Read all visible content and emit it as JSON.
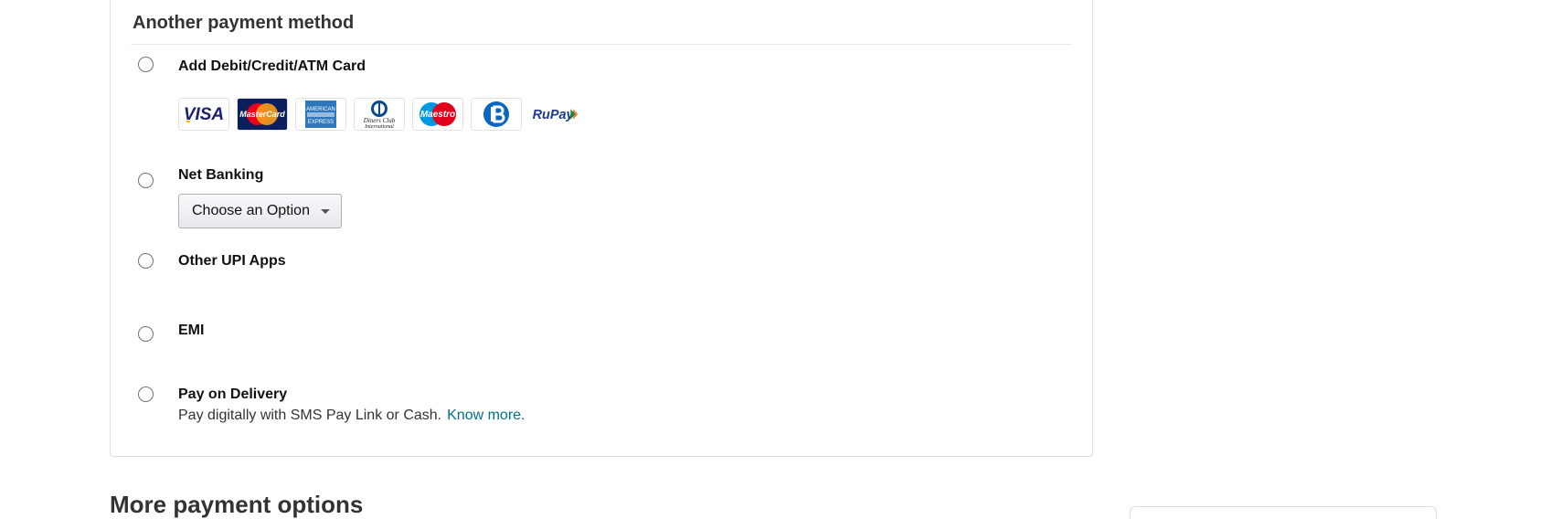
{
  "section": {
    "title": "Another payment method"
  },
  "options": {
    "card": {
      "label": "Add Debit/Credit/ATM Card"
    },
    "net_banking": {
      "label": "Net Banking",
      "select_value": "Choose an Option"
    },
    "upi": {
      "label": "Other UPI Apps"
    },
    "emi": {
      "label": "EMI"
    },
    "pod": {
      "label": "Pay on Delivery",
      "description": "Pay digitally with SMS Pay Link or Cash.",
      "link": "Know more."
    }
  },
  "card_logos": [
    {
      "icon": "visa-icon",
      "text": "VISA",
      "color": "#1a1f71"
    },
    {
      "icon": "mastercard-icon",
      "text": "MasterCard",
      "color": "#eb001b"
    },
    {
      "icon": "amex-icon",
      "text": "AMERICAN EXPRESS",
      "color": "#2e77bc"
    },
    {
      "icon": "diners-club-icon",
      "text": "Diners Club International",
      "color": "#0a4c8a"
    },
    {
      "icon": "maestro-icon",
      "text": "Maestro",
      "color": "#0099df"
    },
    {
      "icon": "bajaj-finserv-icon",
      "text": "B",
      "color": "#0a66c2"
    },
    {
      "icon": "rupay-icon",
      "text": "RuPay",
      "color": "#1b3a8c"
    }
  ],
  "more": {
    "title": "More payment options"
  },
  "colors": {
    "link": "#007185",
    "border": "#dddddd"
  }
}
